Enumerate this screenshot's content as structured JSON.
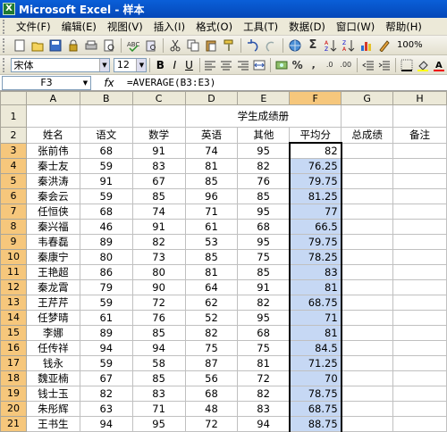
{
  "window": {
    "title": "Microsoft Excel - 样本",
    "app_icon": "excel-icon"
  },
  "menu": [
    "文件(F)",
    "编辑(E)",
    "视图(V)",
    "插入(I)",
    "格式(O)",
    "工具(T)",
    "数据(D)",
    "窗口(W)",
    "帮助(H)"
  ],
  "toolbar": {
    "font": "宋体",
    "size": "12",
    "zoom": "100%",
    "sigma": "Σ",
    "bold": "B",
    "italic": "I",
    "underline": "U"
  },
  "formula": {
    "cell": "F3",
    "fx": "fx",
    "text": "=AVERAGE(B3:E3)"
  },
  "columns": [
    "A",
    "B",
    "C",
    "D",
    "E",
    "F",
    "G",
    "H"
  ],
  "sheet_title": "学生成绩册",
  "headers": [
    "姓名",
    "语文",
    "数学",
    "英语",
    "其他",
    "平均分",
    "总成绩",
    "备注"
  ],
  "rows": [
    {
      "n": "3",
      "name": "张前伟",
      "b": "68",
      "c": "91",
      "d": "74",
      "e": "95",
      "f": "82"
    },
    {
      "n": "4",
      "name": "秦士友",
      "b": "59",
      "c": "83",
      "d": "81",
      "e": "82",
      "f": "76.25"
    },
    {
      "n": "5",
      "name": "秦洪涛",
      "b": "91",
      "c": "67",
      "d": "85",
      "e": "76",
      "f": "79.75"
    },
    {
      "n": "6",
      "name": "秦会云",
      "b": "59",
      "c": "85",
      "d": "96",
      "e": "85",
      "f": "81.25"
    },
    {
      "n": "7",
      "name": "任恒侠",
      "b": "68",
      "c": "74",
      "d": "71",
      "e": "95",
      "f": "77"
    },
    {
      "n": "8",
      "name": "秦兴福",
      "b": "46",
      "c": "91",
      "d": "61",
      "e": "68",
      "f": "66.5"
    },
    {
      "n": "9",
      "name": "韦春磊",
      "b": "89",
      "c": "82",
      "d": "53",
      "e": "95",
      "f": "79.75"
    },
    {
      "n": "10",
      "name": "秦康宁",
      "b": "80",
      "c": "73",
      "d": "85",
      "e": "75",
      "f": "78.25"
    },
    {
      "n": "11",
      "name": "王艳超",
      "b": "86",
      "c": "80",
      "d": "81",
      "e": "85",
      "f": "83"
    },
    {
      "n": "12",
      "name": "秦龙霄",
      "b": "79",
      "c": "90",
      "d": "64",
      "e": "91",
      "f": "81"
    },
    {
      "n": "13",
      "name": "王芹芹",
      "b": "59",
      "c": "72",
      "d": "62",
      "e": "82",
      "f": "68.75"
    },
    {
      "n": "14",
      "name": "任梦晴",
      "b": "61",
      "c": "76",
      "d": "52",
      "e": "95",
      "f": "71"
    },
    {
      "n": "15",
      "name": "李娜",
      "b": "89",
      "c": "85",
      "d": "82",
      "e": "68",
      "f": "81"
    },
    {
      "n": "16",
      "name": "任传祥",
      "b": "94",
      "c": "94",
      "d": "75",
      "e": "75",
      "f": "84.5"
    },
    {
      "n": "17",
      "name": "钱永",
      "b": "59",
      "c": "58",
      "d": "87",
      "e": "81",
      "f": "71.25"
    },
    {
      "n": "18",
      "name": "魏亚楠",
      "b": "67",
      "c": "85",
      "d": "56",
      "e": "72",
      "f": "70"
    },
    {
      "n": "19",
      "name": "钱士玉",
      "b": "82",
      "c": "83",
      "d": "68",
      "e": "82",
      "f": "78.75"
    },
    {
      "n": "20",
      "name": "朱彤辉",
      "b": "63",
      "c": "71",
      "d": "48",
      "e": "83",
      "f": "68.75"
    },
    {
      "n": "21",
      "name": "王书生",
      "b": "94",
      "c": "95",
      "d": "72",
      "e": "94",
      "f": "88.75"
    }
  ]
}
